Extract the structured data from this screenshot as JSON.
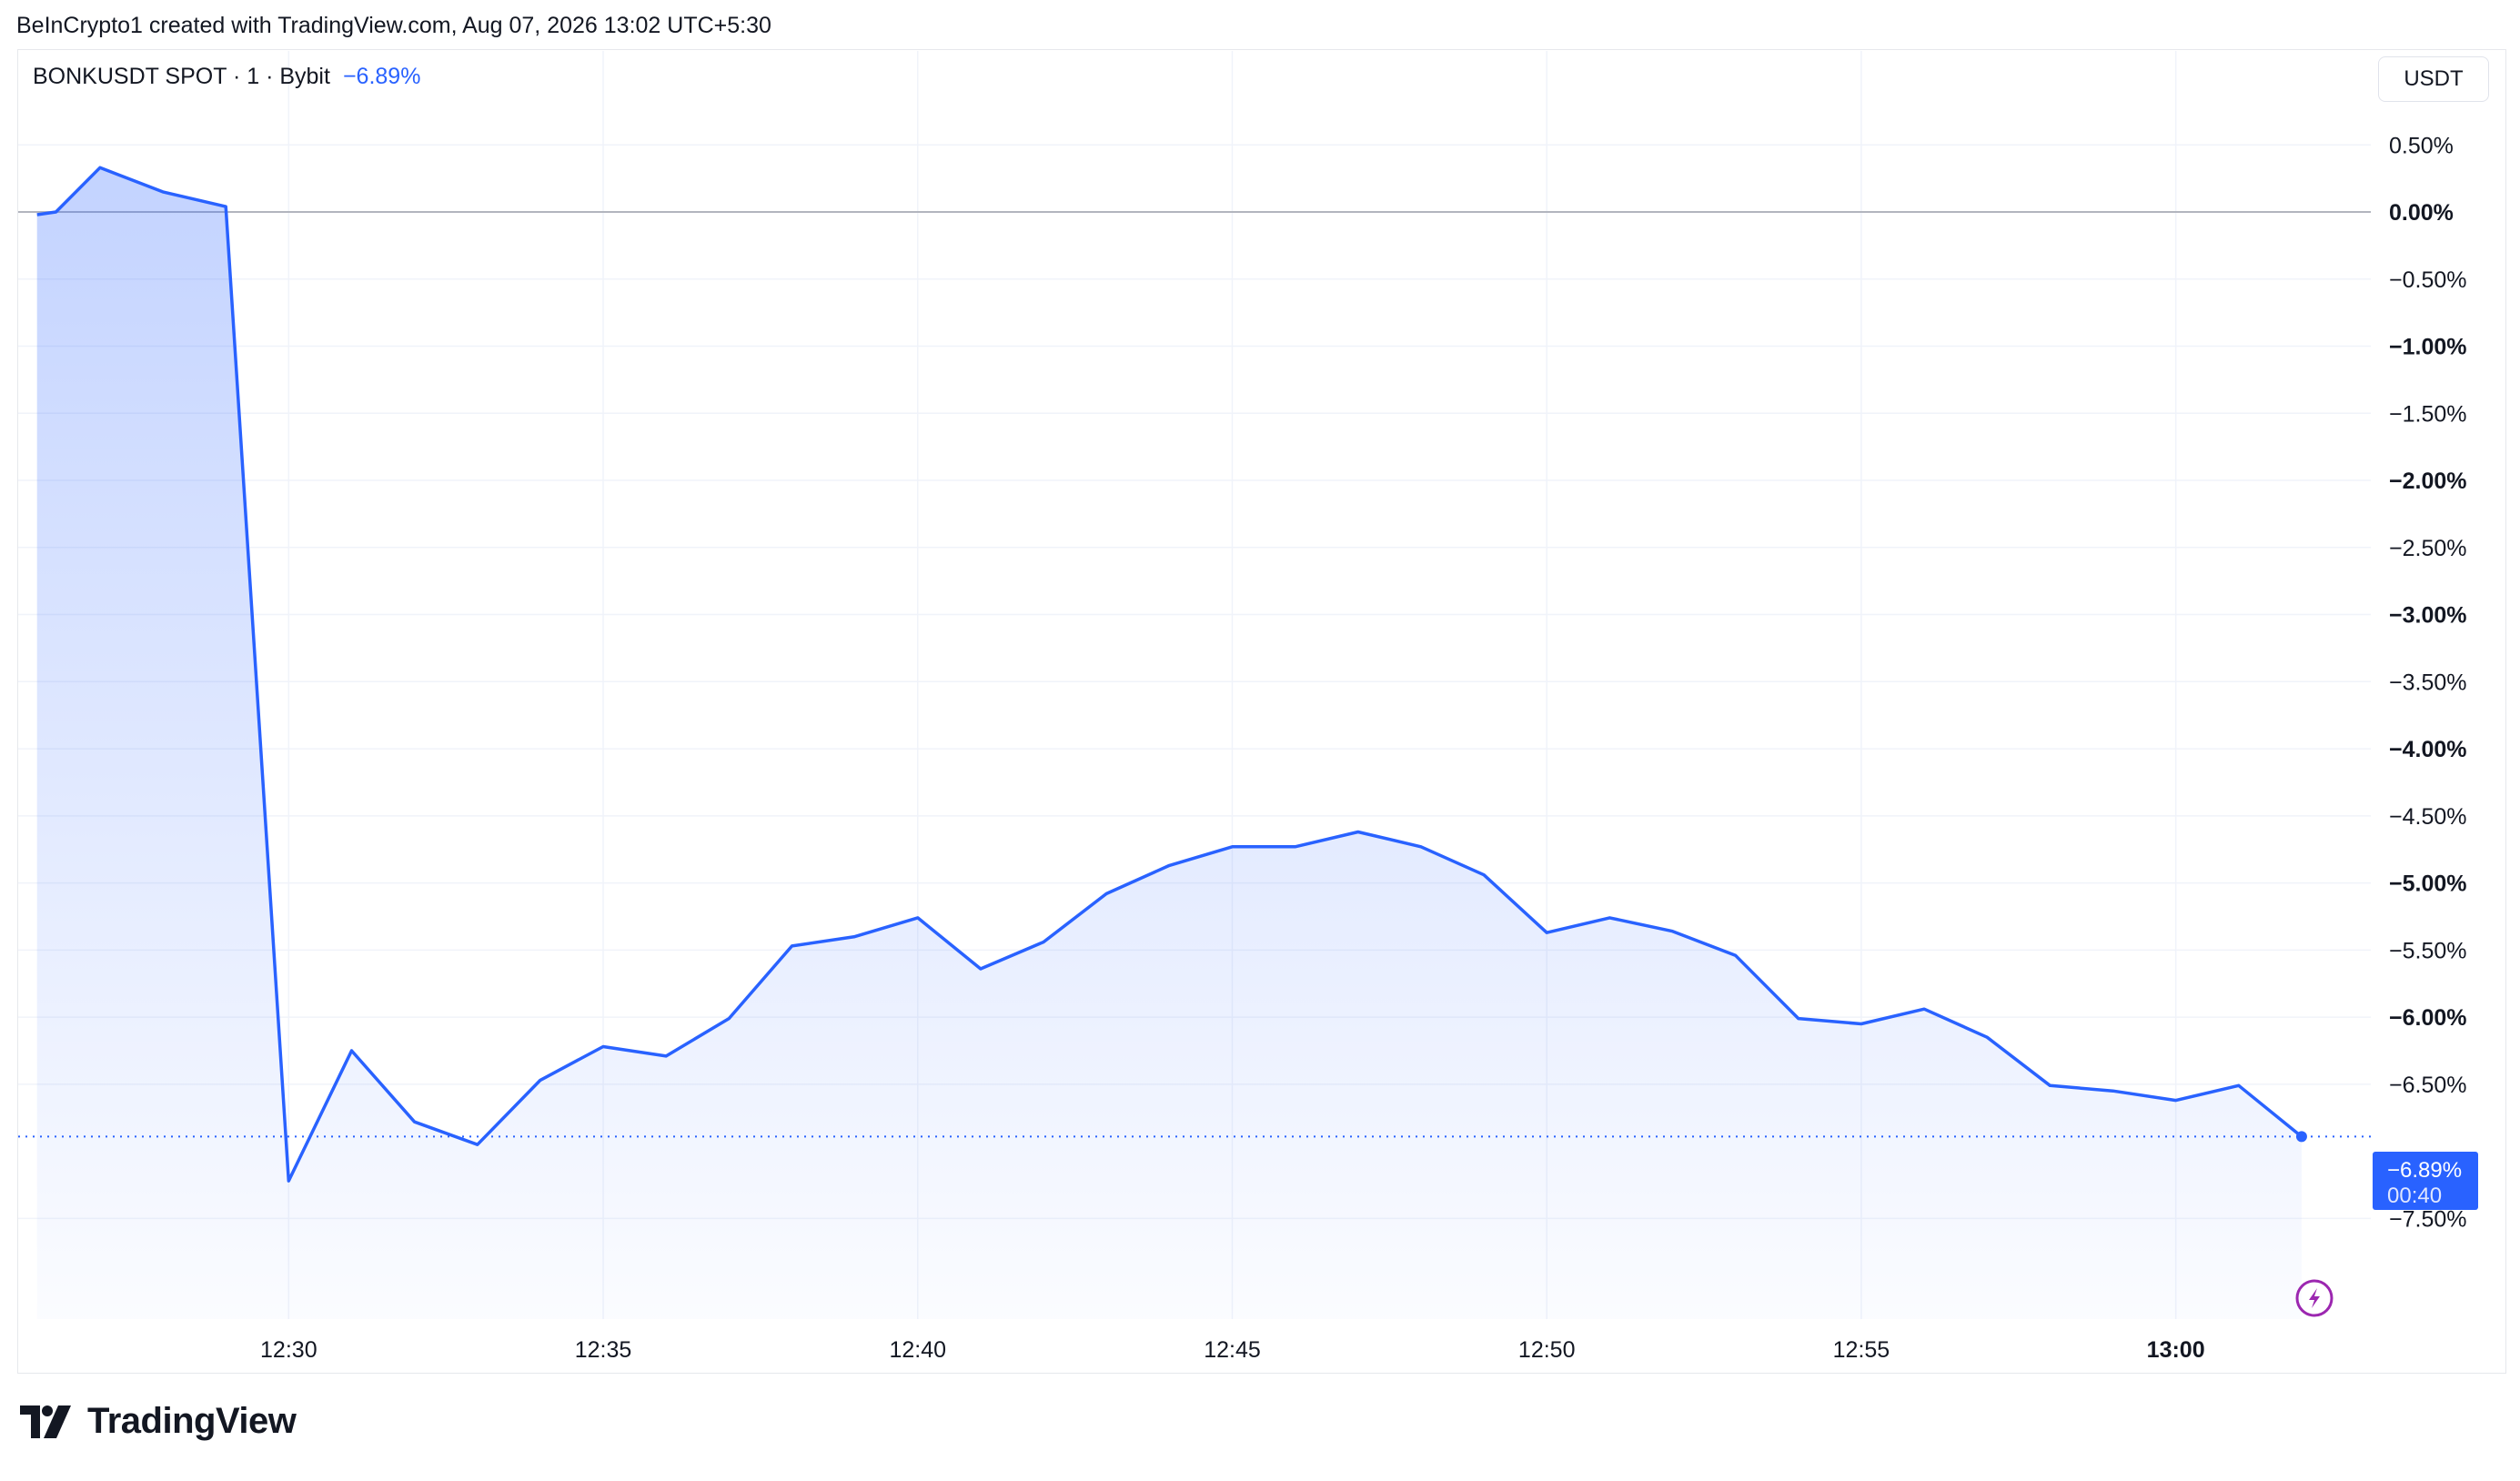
{
  "header": {
    "attribution": "BeInCrypto1 created with TradingView.com, Aug 07, 2026 13:02 UTC+5:30"
  },
  "legend": {
    "symbol": "BONKUSDT SPOT · 1 · Bybit",
    "change": "−6.89%"
  },
  "currency_button": {
    "label": "USDT"
  },
  "last_price_tag": {
    "value": "−6.89%",
    "countdown": "00:40"
  },
  "brand": {
    "name": "TradingView"
  },
  "colors": {
    "line": "#2962ff",
    "tag_bg": "#2962ff",
    "replay_icon": "#9c27b0"
  },
  "icons": [
    "tradingview-logo-icon",
    "lightning-icon"
  ],
  "chart_data": {
    "type": "area",
    "title": "",
    "xlabel": "",
    "ylabel": "",
    "x_unit": "minutes since 12:26",
    "x": [
      0,
      0.3,
      1,
      2,
      3,
      4,
      5,
      6,
      7,
      8,
      9,
      10,
      11,
      12,
      13,
      14,
      15,
      16,
      17,
      18,
      19,
      20,
      21,
      22,
      23,
      24,
      25,
      26,
      27,
      28,
      29,
      30,
      31,
      32,
      33,
      34,
      35,
      36
    ],
    "y": [
      -0.02,
      0.0,
      0.33,
      0.15,
      0.04,
      -7.22,
      -6.25,
      -6.78,
      -6.95,
      -6.47,
      -6.22,
      -6.29,
      -6.01,
      -5.47,
      -5.4,
      -5.26,
      -5.64,
      -5.44,
      -5.08,
      -4.87,
      -4.73,
      -4.73,
      -4.62,
      -4.73,
      -4.94,
      -5.37,
      -5.26,
      -5.36,
      -5.54,
      -6.01,
      -6.05,
      -5.94,
      -6.15,
      -6.51,
      -6.55,
      -6.62,
      -6.51,
      -6.89
    ],
    "x_ticks": [
      {
        "pos": 4,
        "label": "12:30",
        "bold": false
      },
      {
        "pos": 9,
        "label": "12:35",
        "bold": false
      },
      {
        "pos": 14,
        "label": "12:40",
        "bold": false
      },
      {
        "pos": 19,
        "label": "12:45",
        "bold": false
      },
      {
        "pos": 24,
        "label": "12:50",
        "bold": false
      },
      {
        "pos": 29,
        "label": "12:55",
        "bold": false
      },
      {
        "pos": 34,
        "label": "13:00",
        "bold": true
      }
    ],
    "y_ticks": [
      {
        "value": 0.5,
        "label": "0.50%",
        "bold": false
      },
      {
        "value": 0.0,
        "label": "0.00%",
        "bold": true
      },
      {
        "value": -0.5,
        "label": "−0.50%",
        "bold": false
      },
      {
        "value": -1.0,
        "label": "−1.00%",
        "bold": true
      },
      {
        "value": -1.5,
        "label": "−1.50%",
        "bold": false
      },
      {
        "value": -2.0,
        "label": "−2.00%",
        "bold": true
      },
      {
        "value": -2.5,
        "label": "−2.50%",
        "bold": false
      },
      {
        "value": -3.0,
        "label": "−3.00%",
        "bold": true
      },
      {
        "value": -3.5,
        "label": "−3.50%",
        "bold": false
      },
      {
        "value": -4.0,
        "label": "−4.00%",
        "bold": true
      },
      {
        "value": -4.5,
        "label": "−4.50%",
        "bold": false
      },
      {
        "value": -5.0,
        "label": "−5.00%",
        "bold": true
      },
      {
        "value": -5.5,
        "label": "−5.50%",
        "bold": false
      },
      {
        "value": -6.0,
        "label": "−6.00%",
        "bold": true
      },
      {
        "value": -6.5,
        "label": "−6.50%",
        "bold": false
      },
      {
        "value": -7.5,
        "label": "−7.50%",
        "bold": false
      }
    ],
    "ylim": [
      -8.25,
      1.2
    ],
    "xlim": [
      -0.3,
      37.1
    ],
    "baseline": 0,
    "last_value": -6.89,
    "grid": true,
    "legend": "top-left"
  }
}
